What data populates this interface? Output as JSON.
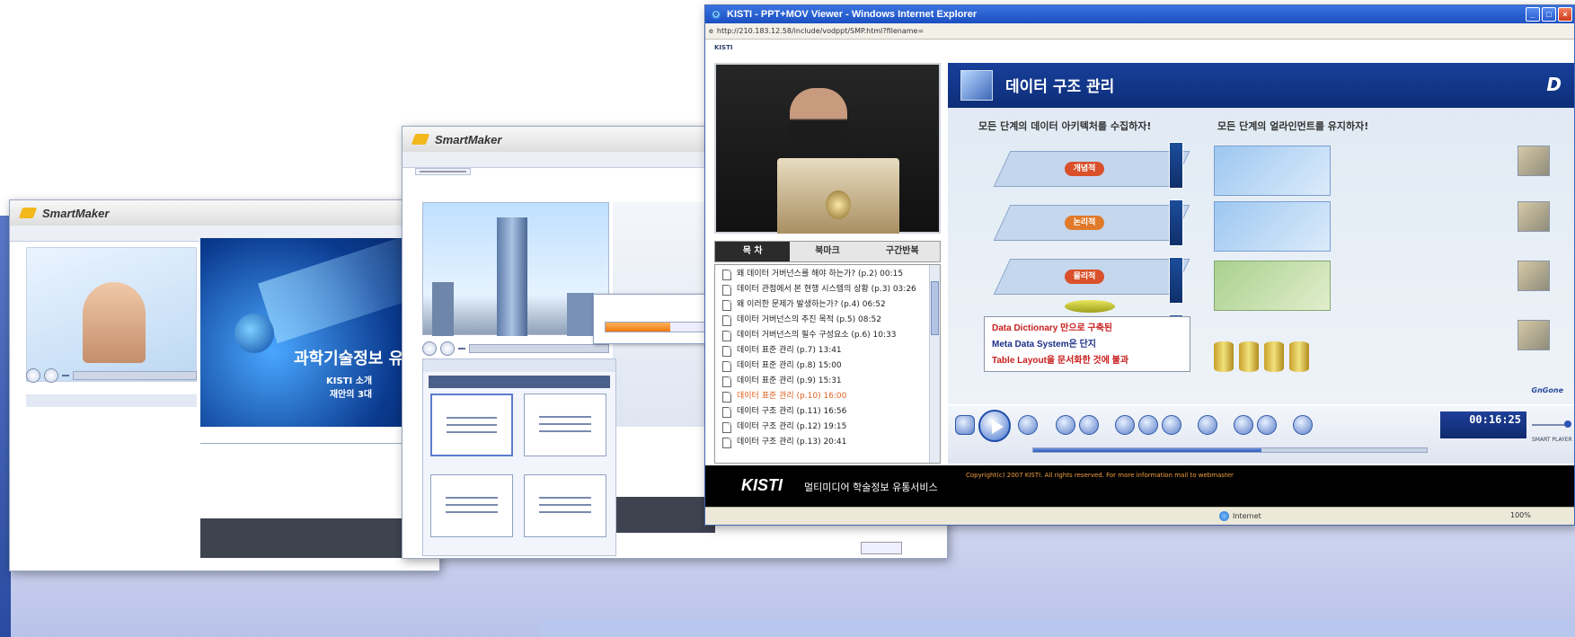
{
  "slide": {
    "title": "",
    "colors": {
      "accent_blue": "#1b4fc2",
      "background_tint": "#b9c3ea"
    }
  },
  "smartmaker1": {
    "logo": "SmartMaker",
    "menu": [
      "",
      "",
      "",
      "",
      "",
      "",
      "",
      ""
    ],
    "banner_title": "과학기술정보 유",
    "banner_sub1": "KISTI 소개",
    "banner_sub2": "재안의 3대",
    "player_label": "",
    "side_title": "",
    "list": [
      {
        "type": "group",
        "text": ""
      },
      {
        "type": "item",
        "text": ""
      },
      {
        "type": "item",
        "text": ""
      },
      {
        "type": "item",
        "text": ""
      },
      {
        "type": "item",
        "text": ""
      },
      {
        "type": "item",
        "text": ""
      },
      {
        "type": "item",
        "text": ""
      },
      {
        "type": "item",
        "text": ""
      },
      {
        "type": "group",
        "text": ""
      },
      {
        "type": "item",
        "text": ""
      },
      {
        "type": "item",
        "text": ""
      }
    ],
    "table_headers": [
      "",
      ""
    ],
    "table_rows": [
      [
        "",
        ""
      ],
      [
        "",
        ""
      ],
      [
        "",
        ""
      ],
      [
        "",
        ""
      ],
      [
        "",
        ""
      ],
      [
        "",
        ""
      ]
    ],
    "info_label1": "",
    "info_label2": ""
  },
  "smartmaker2": {
    "logo": "SmartMaker",
    "menu": [
      "",
      "",
      "",
      "",
      "",
      "",
      "",
      ""
    ],
    "dropdown": [
      "",
      "",
      "",
      ""
    ],
    "player_label": "",
    "dialog_text": "",
    "progress_fraction": 0.62,
    "thumb_panel_title": "",
    "thumb_panel_sub": "",
    "table_headers": [
      "",
      ""
    ],
    "table_rows": [
      [
        "",
        ""
      ],
      [
        "",
        ""
      ],
      [
        "",
        ""
      ],
      [
        "",
        ""
      ],
      [
        "",
        ""
      ]
    ],
    "info_label1": "",
    "info_label2": "",
    "close_label": ""
  },
  "viewer": {
    "window_title": "KISTI - PPT+MOV Viewer - Windows Internet Explorer",
    "address": "http://210.183.12.58/include/vodppt/SMP.html?filename=",
    "page_logo": "KISTI",
    "tabs": [
      "목 차",
      "북마크",
      "구간반복"
    ],
    "toc": [
      {
        "text": "왜 데이터 거버넌스를 해야 하는가? (p.2) 00:15",
        "current": false
      },
      {
        "text": "데이터 관점에서 본 현행 시스템의 상황 (p.3) 03:26",
        "current": false
      },
      {
        "text": "왜 이러한 문제가 발생하는가? (p.4) 06:52",
        "current": false
      },
      {
        "text": "데이터 거버넌스의 추진 목적 (p.5) 08:52",
        "current": false
      },
      {
        "text": "데이터 거버넌스의 필수 구성요소 (p.6) 10:33",
        "current": false
      },
      {
        "text": "데이터 표준 관리 (p.7) 13:41",
        "current": false
      },
      {
        "text": "데이터 표준 관리 (p.8) 15:00",
        "current": false
      },
      {
        "text": "데이터 표준 관리 (p.9) 15:31",
        "current": false
      },
      {
        "text": "데이터 표준 관리 (p.10) 16:00",
        "current": true
      },
      {
        "text": "데이터 구조 관리 (p.11) 16:56",
        "current": false
      },
      {
        "text": "데이터 구조 관리 (p.12) 19:15",
        "current": false
      },
      {
        "text": "데이터 구조 관리 (p.13) 20:41",
        "current": false
      }
    ],
    "slide": {
      "title": "데이터 구조 관리",
      "head_left": "모든 단계의 데이터 아키텍처를 수집하자!",
      "head_right": "모든 단계의 얼라인먼트를 유지하자!",
      "plane_labels": [
        "개념적",
        "논리적",
        "물리적"
      ],
      "note_line1": "Data Dictionary 만으로 구축된",
      "note_line2": "Meta Data System은 단지",
      "note_line3": "Table Layout을 문서화한 것에 불과",
      "signature": "GnGone",
      "logo": "D"
    },
    "time": "00:16:25",
    "time_total": "",
    "progress_fraction": 0.58,
    "player_tag": "SMART PLAYER",
    "footer_logo": "KISTI",
    "footer_service": "멀티미디어 학술정보 유통서비스",
    "footer_text": "",
    "footer_copy": "Copyright(c) 2007 KISTI. All rights reserved. For more information mail to webmaster",
    "status_zone": "Internet",
    "zoom": "100%"
  }
}
